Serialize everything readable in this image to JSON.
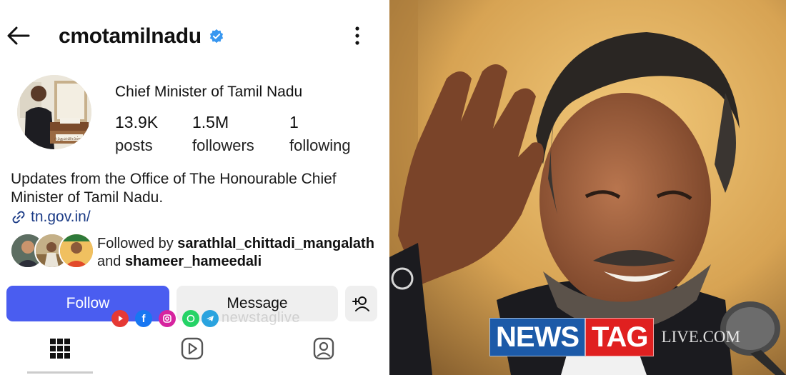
{
  "profile": {
    "username": "cmotamilnadu",
    "display_name": "Chief Minister of Tamil Nadu",
    "stats": [
      {
        "value": "13.9K",
        "label": "posts"
      },
      {
        "value": "1.5M",
        "label": "followers"
      },
      {
        "value": "1",
        "label": "following"
      }
    ],
    "bio": "Updates from the Office of The Honourable Chief Minister of Tamil Nadu.",
    "link": "tn.gov.in/",
    "followed_by": {
      "prefix": "Followed by",
      "user1": "sarathlal_chittadi_mangalath",
      "conjunction": "and",
      "user2": "shameer_hameedali"
    }
  },
  "actions": {
    "follow_label": "Follow",
    "message_label": "Message"
  },
  "overlay": {
    "watermark": "newstaglive"
  },
  "logo": {
    "news": "NEWS",
    "tag": "TAG",
    "live": "LIVE.COM"
  },
  "colors": {
    "follow_button": "#4a5df0",
    "verified_badge": "#3897f0",
    "link": "#1b3b86",
    "logo_blue": "#1c5aa8",
    "logo_red": "#e02020"
  },
  "icons": {
    "back": "back-arrow-icon",
    "verified": "verified-badge-icon",
    "more": "more-options-icon",
    "link": "link-icon",
    "add_user": "add-user-icon",
    "grid": "grid-icon",
    "reels": "reels-icon",
    "tagged": "tagged-icon"
  }
}
